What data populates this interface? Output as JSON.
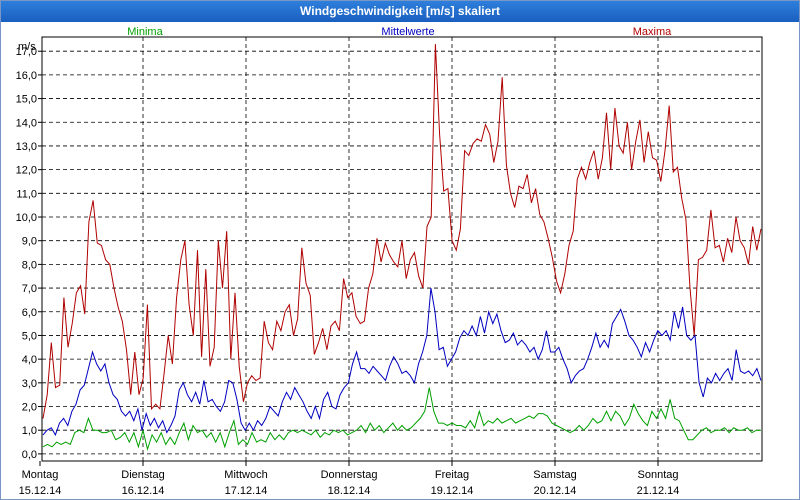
{
  "window": {
    "title": "Windgeschwindigkeit [m/s] skaliert"
  },
  "chart_data": {
    "type": "line",
    "title": "Windgeschwindigkeit [m/s] skaliert",
    "ylabel": "m/s",
    "ylim": [
      -0.3,
      17.6
    ],
    "yticks": [
      "0,0",
      "1,0",
      "2,0",
      "3,0",
      "4,0",
      "5,0",
      "6,0",
      "7,0",
      "8,0",
      "9,0",
      "10,0",
      "11,0",
      "12,0",
      "13,0",
      "14,0",
      "15,0",
      "16,0",
      "17,0"
    ],
    "x_day_labels": [
      {
        "day": "Montag",
        "date": "15.12.14"
      },
      {
        "day": "Dienstag",
        "date": "16.12.14"
      },
      {
        "day": "Mittwoch",
        "date": "17.12.14"
      },
      {
        "day": "Donnerstag",
        "date": "18.12.14"
      },
      {
        "day": "Freitag",
        "date": "19.12.14"
      },
      {
        "day": "Samstag",
        "date": "20.12.14"
      },
      {
        "day": "Sonntag",
        "date": "21.12.14"
      }
    ],
    "grid": true,
    "legend_position": "top",
    "series": [
      {
        "name": "Minima",
        "color": "#00a000",
        "values": [
          0.3,
          0.4,
          0.3,
          0.5,
          0.4,
          0.5,
          0.4,
          0.9,
          1.0,
          0.9,
          1.5,
          1.0,
          1.0,
          0.9,
          0.9,
          1.0,
          0.6,
          0.7,
          0.9,
          0.5,
          0.9,
          0.3,
          1.0,
          0.2,
          0.8,
          0.5,
          0.9,
          0.4,
          0.7,
          0.4,
          0.9,
          1.3,
          0.6,
          1.2,
          0.9,
          1.0,
          0.7,
          0.9,
          0.5,
          0.9,
          0.3,
          0.9,
          1.4,
          0.4,
          0.6,
          0.4,
          0.9,
          0.5,
          0.6,
          0.5,
          0.9,
          0.6,
          0.8,
          0.6,
          0.9,
          1.0,
          0.9,
          1.0,
          0.9,
          0.8,
          1.0,
          0.7,
          0.9,
          0.8,
          1.0,
          0.9,
          1.0,
          0.8,
          0.9,
          1.0,
          1.2,
          0.9,
          1.3,
          1.0,
          1.2,
          0.9,
          1.1,
          1.3,
          1.0,
          1.2,
          1.0,
          1.1,
          1.3,
          1.5,
          1.8,
          2.8,
          1.8,
          1.3,
          1.3,
          1.2,
          1.3,
          1.2,
          1.2,
          1.1,
          1.4,
          1.1,
          1.8,
          1.2,
          1.4,
          1.3,
          1.5,
          1.3,
          1.4,
          1.5,
          1.3,
          1.4,
          1.5,
          1.6,
          1.5,
          1.7,
          1.7,
          1.6,
          1.3,
          1.2,
          1.1,
          1.0,
          0.9,
          1.0,
          1.2,
          1.0,
          1.2,
          1.5,
          1.3,
          1.4,
          1.8,
          1.4,
          1.8,
          1.6,
          1.2,
          1.5,
          2.1,
          1.7,
          1.4,
          1.2,
          1.8,
          1.5,
          1.9,
          1.5,
          2.3,
          1.5,
          1.4,
          1.0,
          0.6,
          0.6,
          0.8,
          1.0,
          1.1,
          0.9,
          1.0,
          1.0,
          1.1,
          0.9,
          1.1,
          1.0,
          1.0,
          1.1,
          0.9,
          1.0,
          1.0
        ]
      },
      {
        "name": "Mittelwerte",
        "color": "#0000c0",
        "values": [
          0.8,
          1.0,
          1.1,
          0.8,
          1.3,
          1.5,
          1.2,
          1.8,
          2.1,
          2.7,
          2.9,
          3.6,
          4.3,
          3.8,
          3.5,
          3.8,
          3.0,
          2.5,
          2.3,
          1.8,
          1.6,
          1.8,
          1.4,
          1.9,
          1.0,
          1.7,
          1.2,
          1.5,
          1.1,
          1.4,
          0.9,
          1.2,
          1.6,
          2.7,
          3.0,
          2.5,
          2.2,
          2.6,
          2.1,
          3.1,
          2.2,
          2.3,
          2.0,
          1.8,
          2.2,
          3.1,
          3.0,
          2.3,
          1.3,
          1.0,
          1.3,
          1.0,
          1.4,
          1.2,
          1.5,
          2.0,
          1.8,
          1.6,
          2.2,
          2.6,
          2.3,
          2.8,
          2.5,
          2.2,
          1.8,
          1.5,
          2.0,
          1.5,
          2.3,
          2.6,
          2.0,
          1.9,
          2.5,
          2.8,
          3.0,
          3.8,
          4.3,
          3.6,
          3.6,
          3.4,
          3.7,
          3.5,
          3.3,
          3.1,
          3.7,
          4.1,
          3.8,
          3.4,
          3.5,
          3.3,
          3.0,
          3.8,
          4.3,
          5.0,
          7.0,
          6.0,
          4.4,
          4.5,
          3.7,
          4.0,
          4.3,
          4.9,
          5.2,
          5.0,
          5.4,
          5.0,
          5.8,
          5.1,
          6.0,
          5.5,
          5.9,
          5.2,
          4.7,
          4.8,
          5.1,
          4.6,
          4.8,
          4.6,
          4.3,
          4.5,
          4.0,
          4.4,
          5.2,
          4.3,
          4.3,
          4.5,
          4.0,
          3.6,
          3.0,
          3.3,
          3.5,
          3.6,
          4.0,
          4.5,
          5.1,
          4.5,
          4.8,
          4.5,
          5.5,
          5.8,
          6.1,
          5.6,
          5.0,
          4.8,
          4.5,
          4.1,
          4.7,
          4.3,
          4.8,
          5.2,
          5.0,
          5.2,
          4.8,
          6.0,
          5.3,
          6.2,
          5.0,
          4.8,
          5.0,
          3.0,
          2.4,
          3.2,
          3.0,
          3.4,
          3.1,
          3.4,
          3.6,
          3.1,
          4.4,
          3.5,
          3.4,
          3.5,
          3.3,
          3.6,
          3.1
        ]
      },
      {
        "name": "Maxima",
        "color": "#b00000",
        "values": [
          1.5,
          2.5,
          4.7,
          2.8,
          2.9,
          6.6,
          4.5,
          5.5,
          6.8,
          7.1,
          5.9,
          9.8,
          10.7,
          8.9,
          8.8,
          8.2,
          8.0,
          7.0,
          6.2,
          5.6,
          4.4,
          2.5,
          4.3,
          2.5,
          3.2,
          6.3,
          1.9,
          2.1,
          1.9,
          3.4,
          5.0,
          3.8,
          6.6,
          8.2,
          9.0,
          6.3,
          5.0,
          8.6,
          4.1,
          7.8,
          3.7,
          4.5,
          9.0,
          7.0,
          9.4,
          4.0,
          6.8,
          3.7,
          2.2,
          3.0,
          3.3,
          3.1,
          3.2,
          5.6,
          4.7,
          4.4,
          5.6,
          5.2,
          6.0,
          6.3,
          5.0,
          5.7,
          8.7,
          7.2,
          6.7,
          4.2,
          4.7,
          5.3,
          4.4,
          5.4,
          5.6,
          5.2,
          7.4,
          6.6,
          6.8,
          5.8,
          5.5,
          5.6,
          7.0,
          7.6,
          9.1,
          8.1,
          8.9,
          8.4,
          8.1,
          7.9,
          9.0,
          7.4,
          8.2,
          8.5,
          7.5,
          7.0,
          9.6,
          10.0,
          17.3,
          13.5,
          11.1,
          11.2,
          9.0,
          8.6,
          9.5,
          12.8,
          12.6,
          13.1,
          13.3,
          13.2,
          13.9,
          13.5,
          12.3,
          13.2,
          15.9,
          12.2,
          11.0,
          10.4,
          11.3,
          11.2,
          11.8,
          10.6,
          11.2,
          10.1,
          9.8,
          9.1,
          8.3,
          7.3,
          6.8,
          7.6,
          8.8,
          9.4,
          11.6,
          12.1,
          11.6,
          12.3,
          12.8,
          11.6,
          12.5,
          14.4,
          12.0,
          14.6,
          13.0,
          12.7,
          14.0,
          12.0,
          13.2,
          14.1,
          12.3,
          13.6,
          12.5,
          12.4,
          11.5,
          12.8,
          14.7,
          11.9,
          12.1,
          10.8,
          9.9,
          7.0,
          5.0,
          8.2,
          8.3,
          8.6,
          10.3,
          8.7,
          8.8,
          8.1,
          9.1,
          8.5,
          10.0,
          9.0,
          8.7,
          8.0,
          9.6,
          8.6,
          9.5
        ]
      }
    ]
  }
}
